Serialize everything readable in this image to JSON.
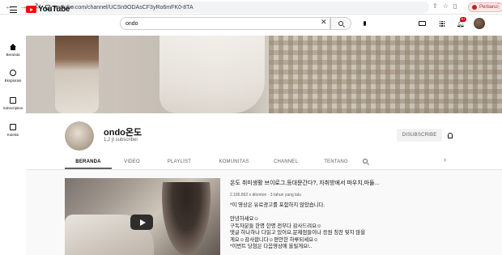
{
  "browser": {
    "url": "youtube.com/channel/UCSn9ODAsCF3yRo6mFK0-8TA",
    "update_label": "Perbarui",
    "menu_glyph": "⋮"
  },
  "header": {
    "logo_text": "YouTube",
    "logo_country": "ID",
    "search_value": "ondo",
    "search_clear": "✕",
    "notif_count": "9+"
  },
  "guide": [
    {
      "label": "Beranda",
      "icon": "home-icon"
    },
    {
      "label": "Eksplorasi",
      "icon": "explore-icon"
    },
    {
      "label": "Subscription",
      "icon": "subscriptions-icon"
    },
    {
      "label": "Koleksi",
      "icon": "library-icon"
    }
  ],
  "channel": {
    "name": "ondo온도",
    "subscribers": "1,2 jt subscriber",
    "subscribe_label": "DISUBSCRIBE"
  },
  "tabs": [
    {
      "label": "BERANDA",
      "active": true
    },
    {
      "label": "VIDEO",
      "active": false
    },
    {
      "label": "PLAYLIST",
      "active": false
    },
    {
      "label": "KOMUNITAS",
      "active": false
    },
    {
      "label": "CHANNEL",
      "active": false
    },
    {
      "label": "TENTANG",
      "active": false
    }
  ],
  "tab_next": "›",
  "featured": {
    "title": "온도 취미생활 브이로그,등대문간다?, 자취방에서 파우치,마들...",
    "meta": "2.186.892 x ditonton · 3 tahun yang lalu",
    "desc": [
      "*이 영상은 유료광고를 포함하지 않았습니다.",
      "",
      "안녕하세요☺",
      "구독자분들 한명 한명 전부다 감사드려요☺",
      "댓글 하나하나 다읽고 있어요.문제점들이나 응원 칭찬 잊지 않을",
      "게요☺감사합니다☺편안한 하루되세요☺",
      "*이번트 당첨은 다음영상에 올릴게요!.."
    ]
  },
  "colors": {
    "brand_red": "#ff0000",
    "notif_red": "#cc0000"
  }
}
